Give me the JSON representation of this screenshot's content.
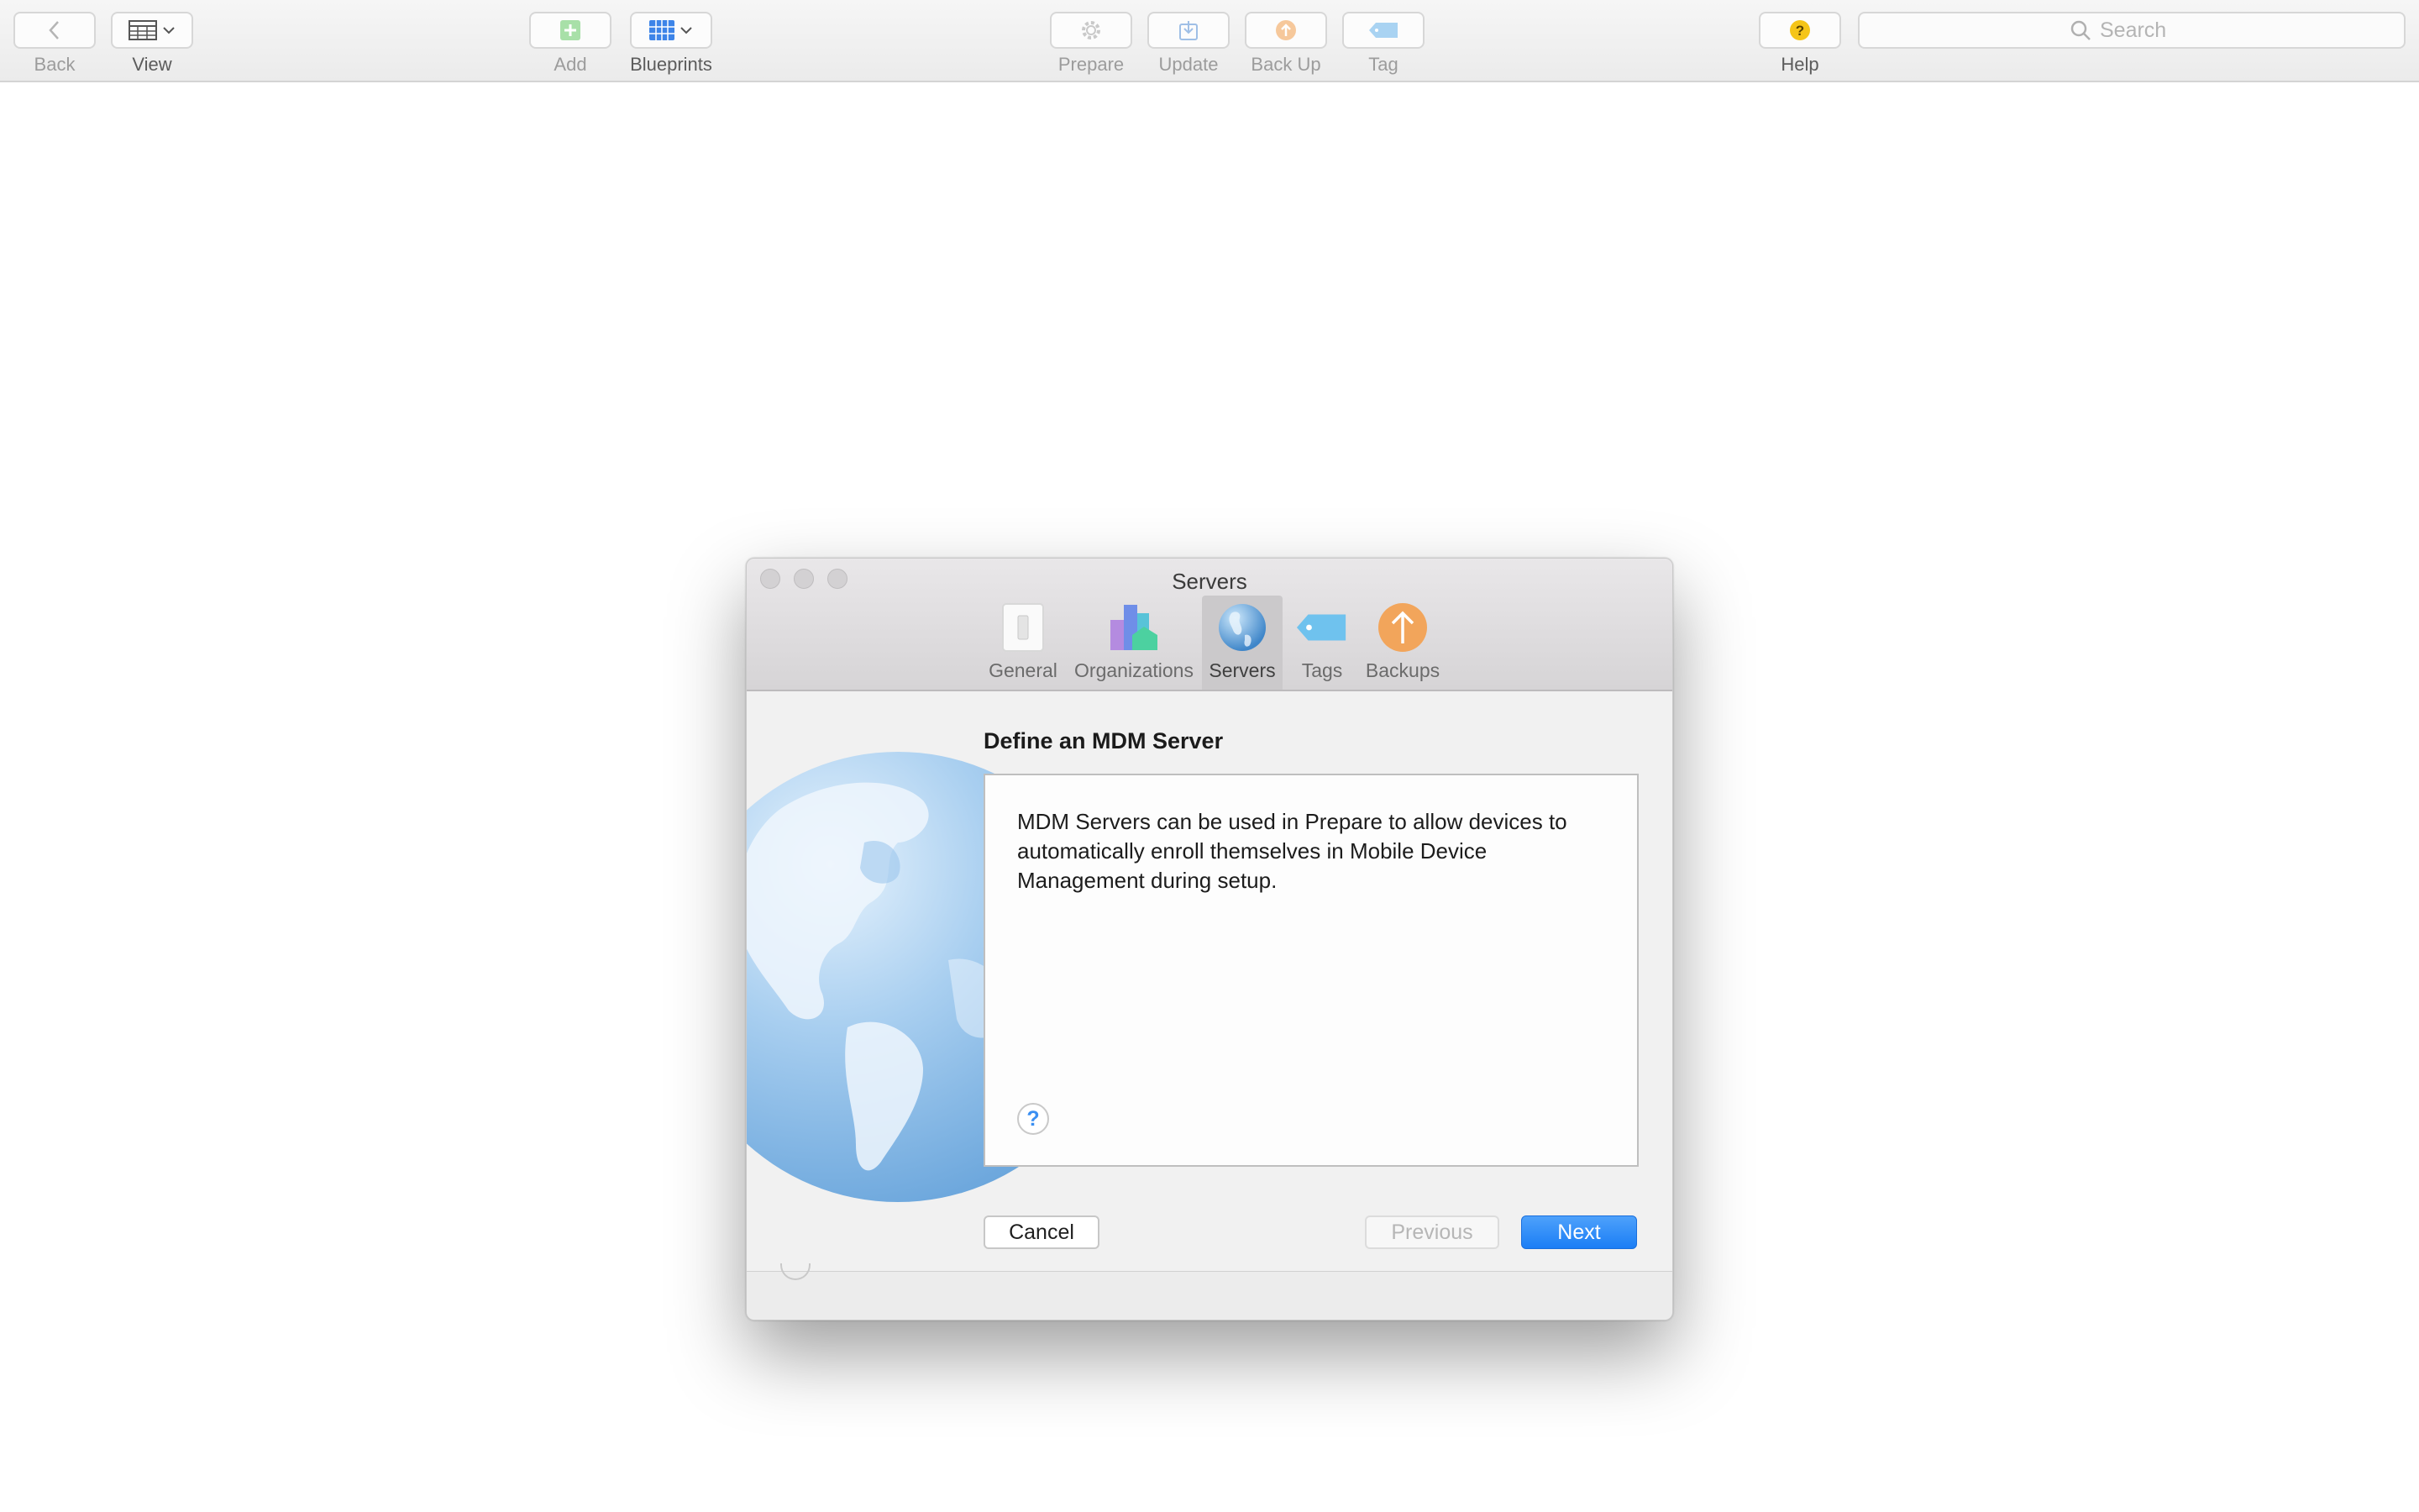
{
  "toolbar": {
    "back_label": "Back",
    "view_label": "View",
    "add_label": "Add",
    "blueprints_label": "Blueprints",
    "prepare_label": "Prepare",
    "update_label": "Update",
    "backup_label": "Back Up",
    "tag_label": "Tag",
    "help_label": "Help",
    "search_placeholder": "Search"
  },
  "dialog": {
    "title": "Servers",
    "tabs": [
      {
        "label": "General",
        "icon": "switch-icon"
      },
      {
        "label": "Organizations",
        "icon": "buildings-icon"
      },
      {
        "label": "Servers",
        "icon": "globe-icon",
        "selected": true
      },
      {
        "label": "Tags",
        "icon": "tag-icon"
      },
      {
        "label": "Backups",
        "icon": "backup-icon"
      }
    ],
    "heading": "Define an MDM Server",
    "description": "MDM Servers can be used in Prepare to allow devices to automatically enroll themselves in Mobile Device Management during setup.",
    "help_glyph": "?",
    "buttons": {
      "cancel": "Cancel",
      "previous": "Previous",
      "next": "Next"
    }
  },
  "colors": {
    "accent": "#1b7ef5",
    "help_yellow": "#f5c518",
    "backup_orange": "#f2a55b",
    "tag_blue": "#6fc2ee"
  }
}
